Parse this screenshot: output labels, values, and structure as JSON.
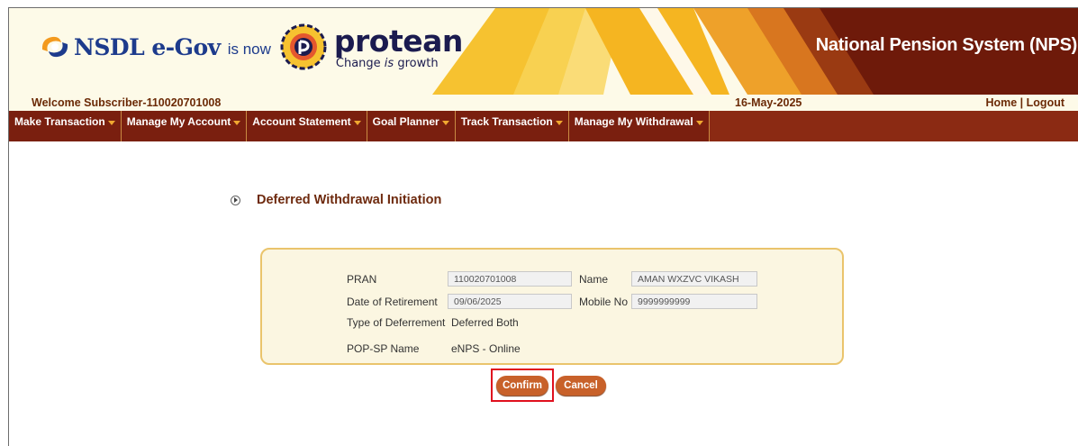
{
  "header": {
    "brand_nsdl": "NSDL e-Gov",
    "brand_isnow": "is now",
    "brand_protean": "protean",
    "tagline_pre": "Change ",
    "tagline_em": "is",
    "tagline_post": " growth",
    "system_title": "National Pension System (NPS)"
  },
  "welcome_bar": {
    "welcome": "Welcome Subscriber-110020701008",
    "date": "16-May-2025",
    "home": "Home",
    "separator": " | ",
    "logout": "Logout"
  },
  "nav": {
    "items": [
      {
        "label": "Make Transaction"
      },
      {
        "label": "Manage My Account"
      },
      {
        "label": "Account Statement"
      },
      {
        "label": "Goal Planner"
      },
      {
        "label": "Track Transaction"
      },
      {
        "label": "Manage My Withdrawal"
      }
    ]
  },
  "page": {
    "title": "Deferred Withdrawal Initiation"
  },
  "details": {
    "pran_label": "PRAN",
    "pran_value": "110020701008",
    "name_label": "Name",
    "name_value": "AMAN WXZVC VIKASH",
    "dor_label": "Date of Retirement",
    "dor_value": "09/06/2025",
    "mobile_label": "Mobile No",
    "mobile_value": "9999999999",
    "deferment_label": "Type of Deferrement",
    "deferment_value": "Deferred Both",
    "popsp_label": "POP-SP Name",
    "popsp_value": "eNPS - Online"
  },
  "actions": {
    "confirm": "Confirm",
    "cancel": "Cancel"
  },
  "colors": {
    "nav_bg": "#8b2a13",
    "header_dark": "#6e1a0a",
    "accent_button": "#c8612a",
    "box_border": "#eac46c",
    "highlight": "#e0101e"
  }
}
